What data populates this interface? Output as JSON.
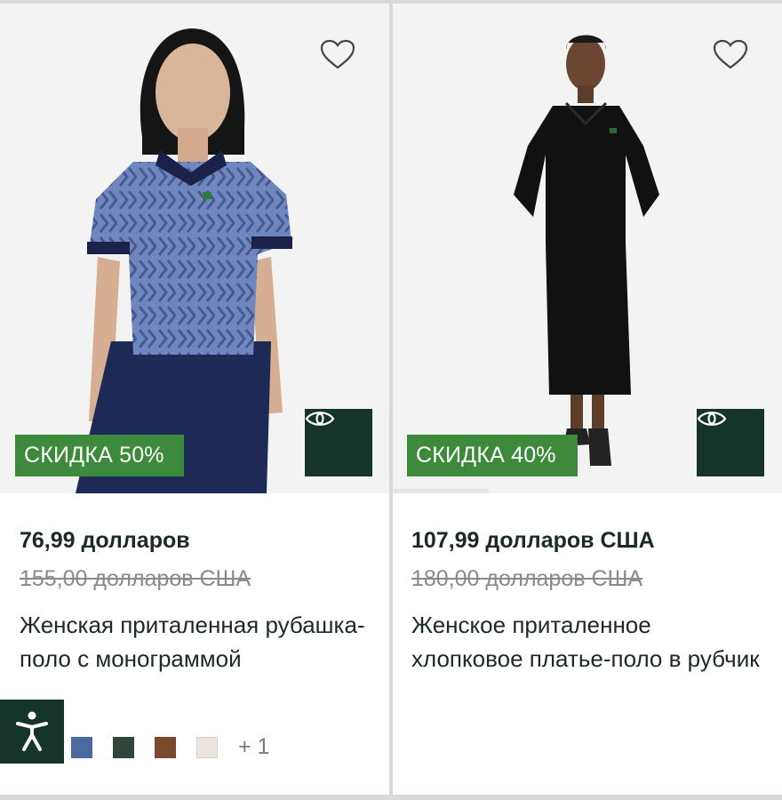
{
  "products": [
    {
      "discount_badge": "СКИДКА 50%",
      "price": "76,99 долларов",
      "old_price": "155,00 долларов США",
      "name": "Женская приталенная рубашка-поло с монограммой",
      "swatches": [
        "#4a6aa0",
        "#2f4638",
        "#7a4a30",
        "#ece4de"
      ],
      "more_colors": "+ 1"
    },
    {
      "discount_badge": "СКИДКА 40%",
      "price": "107,99 долларов США",
      "old_price": "180,00 долларов США",
      "name": "Женское приталенное хлопковое платье-поло в рубчик"
    }
  ],
  "colors": {
    "accent_dark": "#15352a",
    "badge_green": "#3d8a3c"
  },
  "icons": {
    "wishlist": "heart-outline-icon",
    "quick_view": "eye-icon",
    "accessibility": "accessibility-person-icon"
  }
}
